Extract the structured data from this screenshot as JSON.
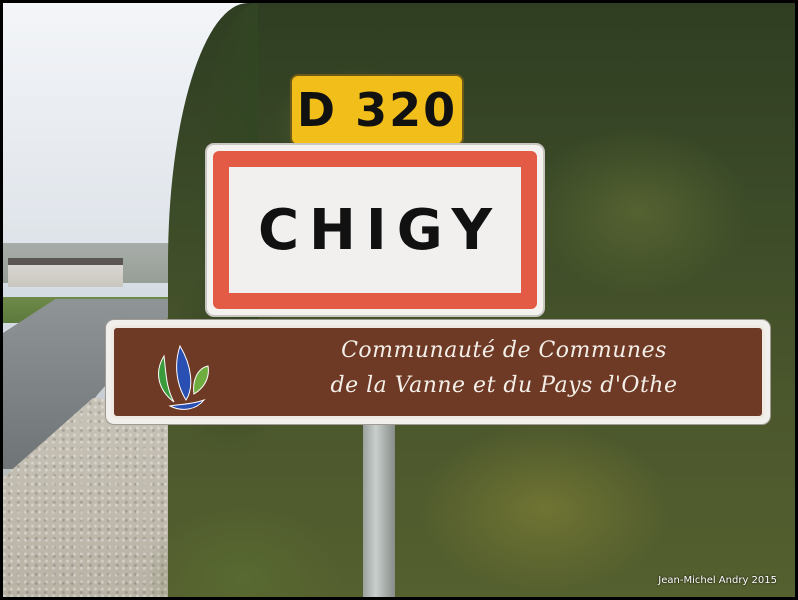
{
  "road_number": "D 320",
  "town_name": "CHIGY",
  "tourism_sign": {
    "line1": "Communauté de Communes",
    "line2": "de la Vanne et du Pays d'Othe"
  },
  "photo_credit": "Jean-Michel Andry 2015",
  "colors": {
    "road_plate": "#f2bf1a",
    "town_border": "#e35b45",
    "tourism_bg": "#6f3a25"
  }
}
